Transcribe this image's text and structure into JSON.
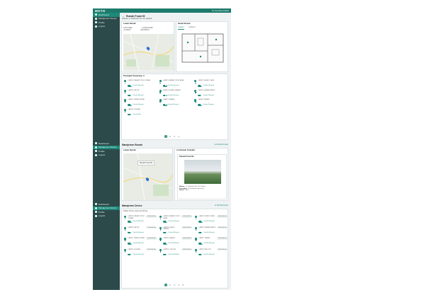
{
  "topbar": {
    "logo": "MOTO",
    "user": "Hi, User Name Default"
  },
  "sidebar": {
    "items": [
      {
        "label": "Dashboard"
      },
      {
        "label": "Manajemen Device"
      },
      {
        "label": "Profile"
      },
      {
        "label": "Logout"
      }
    ]
  },
  "s1": {
    "title": "Rumah Pusat 09",
    "address": "Alamat: Jl. Sudirman No. 09, Jakarta",
    "panel_left_title": "Lokasi Rumah",
    "panel_left_cols": [
      "LATITUDE",
      "LONGITUDE"
    ],
    "panel_left_vals": [
      "-6.20876",
      "106.84513"
    ],
    "panel_right_title": "Denah Rumah",
    "tabs": [
      "Lantai 1",
      "Lantai 2"
    ],
    "devices_title": "Perangkat Terpasang",
    "devices_count": "(8)",
    "devices": [
      {
        "name": "LAMPU KAMAR TIDUR UTAMA",
        "status": "Kondisi Menyala"
      },
      {
        "name": "LAMPU KAMAR TIDUR ANAK",
        "status": "Kondisi Menyala"
      },
      {
        "name": "LAMPU RUANG TAMU",
        "status": "Kondisi Menyala"
      },
      {
        "name": "LAMPU DAPUR",
        "status": "Kondisi Menyala"
      },
      {
        "name": "LAMPU RUANG MAKAN",
        "status": "Kondisi Menyala"
      },
      {
        "name": "LAMPU KAMAR MANDI",
        "status": "Kondisi Menyala"
      },
      {
        "name": "LAMPU TERAS DEPAN",
        "status": "Kondisi Menyala"
      },
      {
        "name": "LAMPU GARASI",
        "status": "Kondisi Menyala"
      },
      {
        "name": "LAMPU TAMAN",
        "status": "Kondisi Menyala"
      },
      {
        "name": "LAMPU GUDANG",
        "status": "Kondisi Mati"
      }
    ],
    "pages": [
      "1",
      "2",
      "3",
      "4"
    ]
  },
  "s2": {
    "title": "Manajemen Rumah",
    "link": "Tambah Rumah",
    "left_title": "Lokasi Rumah",
    "right_title": "List Rumah Terdaftar",
    "house_label": "Rumah Pusat 09",
    "card_title": "Rumah Pusat 09",
    "card_rows": [
      {
        "k": "Alamat",
        "v": "Jl. Sudirman No. 09, Jakarta"
      },
      {
        "k": "Perangkat",
        "v": "8 perangkat terpasang"
      },
      {
        "k": "Status",
        "v": "Aktif"
      }
    ]
  },
  "s3": {
    "title": "Manajemen Device",
    "link": "Tambah Device",
    "subtitle": "Daftar device yang terhubung",
    "badge": "TERHUBUNG",
    "devices": [
      {
        "name": "LAMPU KAMAR TIDUR UTAMA",
        "status": "Kondisi Menyala"
      },
      {
        "name": "LAMPU KAMAR TIDUR ANAK",
        "status": "Kondisi Menyala"
      },
      {
        "name": "LAMPU RUANG TAMU",
        "status": "Kondisi Menyala"
      },
      {
        "name": "LAMPU DAPUR",
        "status": "Kondisi Menyala"
      },
      {
        "name": "LAMPU RUANG MAKAN",
        "status": "Kondisi Menyala"
      },
      {
        "name": "LAMPU KAMAR MANDI",
        "status": "Kondisi Menyala"
      },
      {
        "name": "LAMPU TERAS DEPAN",
        "status": "Kondisi Menyala"
      },
      {
        "name": "LAMPU GARASI",
        "status": "Kondisi Menyala"
      },
      {
        "name": "LAMPU TAMAN",
        "status": "Kondisi Menyala"
      },
      {
        "name": "LAMPU GUDANG",
        "status": "Kondisi Menyala"
      },
      {
        "name": "LAMPU LORONG",
        "status": "Kondisi Menyala"
      },
      {
        "name": "LAMPU BALKON",
        "status": "Kondisi Menyala"
      }
    ],
    "pages": [
      "1",
      "2",
      "3",
      "4",
      "5"
    ]
  },
  "colors": {
    "accent": "#1d8a7a",
    "sidebar": "#2d4a4a",
    "topbar": "#1d7a6c"
  }
}
